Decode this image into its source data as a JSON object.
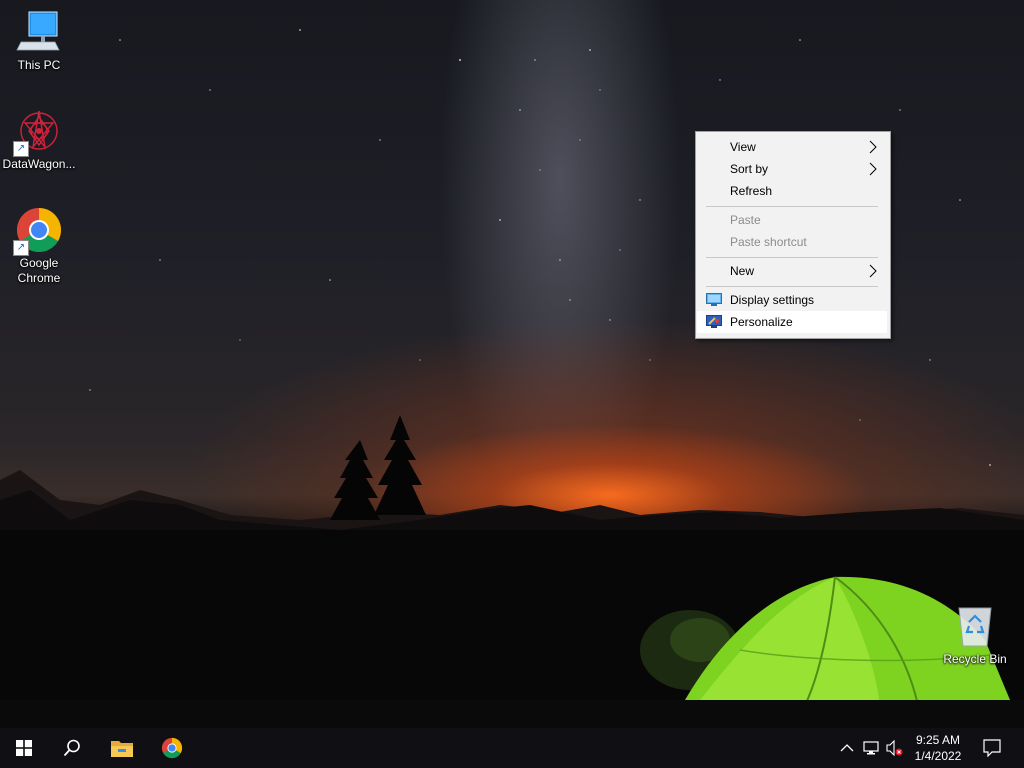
{
  "desktop": {
    "icons": [
      {
        "label": "This PC",
        "icon": "computer-icon"
      },
      {
        "label": "DataWagon...",
        "icon": "datawagon-icon"
      },
      {
        "label": "Google Chrome",
        "icon": "chrome-icon"
      },
      {
        "label": "Recycle Bin",
        "icon": "recycle-bin-icon"
      }
    ]
  },
  "context_menu": {
    "items": [
      {
        "label": "View",
        "has_submenu": true,
        "enabled": true
      },
      {
        "label": "Sort by",
        "has_submenu": true,
        "enabled": true
      },
      {
        "label": "Refresh",
        "enabled": true
      },
      {
        "label": "Paste",
        "enabled": false
      },
      {
        "label": "Paste shortcut",
        "enabled": false
      },
      {
        "label": "New",
        "has_submenu": true,
        "enabled": true
      },
      {
        "label": "Display settings",
        "icon": "display-icon",
        "enabled": true
      },
      {
        "label": "Personalize",
        "icon": "personalize-icon",
        "enabled": true,
        "highlighted": true
      }
    ],
    "submenu_glyph": "›"
  },
  "taskbar": {
    "start": "windows-logo-icon",
    "search": "search-icon",
    "pinned": [
      "file-explorer-icon",
      "chrome-icon"
    ],
    "tray": [
      "chevron-up-icon",
      "network-icon",
      "volume-muted-icon",
      "notification-icon"
    ],
    "time": "9:25 AM",
    "date": "1/4/2022"
  },
  "colors": {
    "menu_bg": "#f2f2f2",
    "menu_highlight": "#ffffff",
    "taskbar_bg": "#101014",
    "tent_green": "#7ed321"
  }
}
